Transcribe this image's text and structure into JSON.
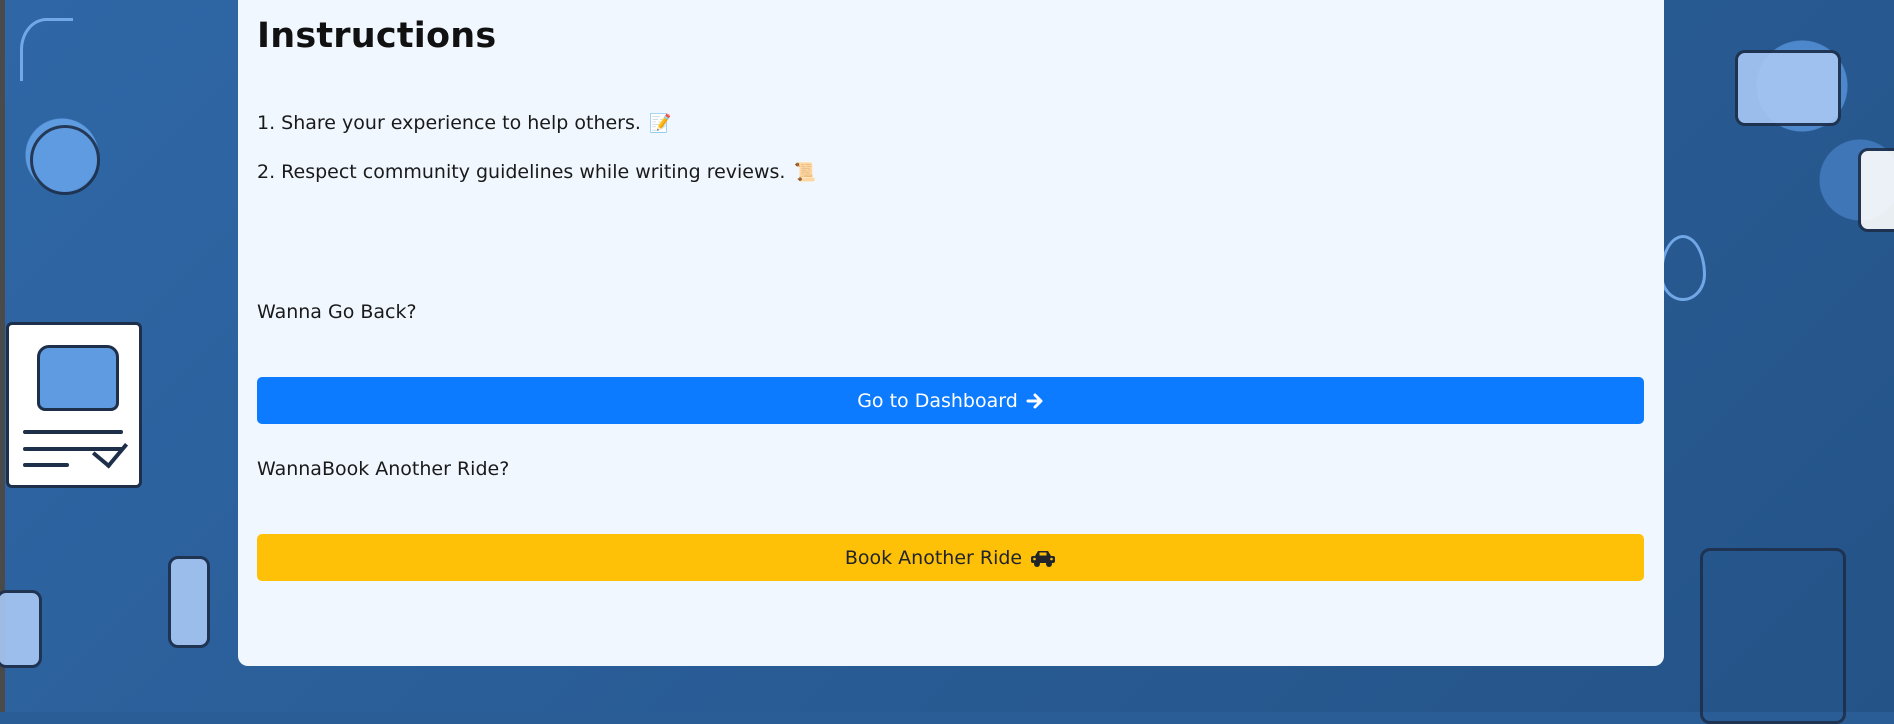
{
  "instructions": {
    "title": "Instructions",
    "items": [
      {
        "text": "1. Share your experience to help others.",
        "emoji": "📝"
      },
      {
        "text": "2. Respect community guidelines while writing reviews.",
        "emoji": "📜"
      }
    ]
  },
  "back_section": {
    "prompt": "Wanna Go Back?",
    "button_label": "Go to Dashboard",
    "button_icon": "arrow-right-icon"
  },
  "book_section": {
    "prompt": "WannaBook Another Ride?",
    "button_label": "Book Another Ride",
    "button_icon": "car-icon"
  },
  "colors": {
    "panel_bg": "#f0f7ff",
    "page_bg": "#2a5d96",
    "primary": "#0d7bff",
    "warning": "#ffc107"
  }
}
